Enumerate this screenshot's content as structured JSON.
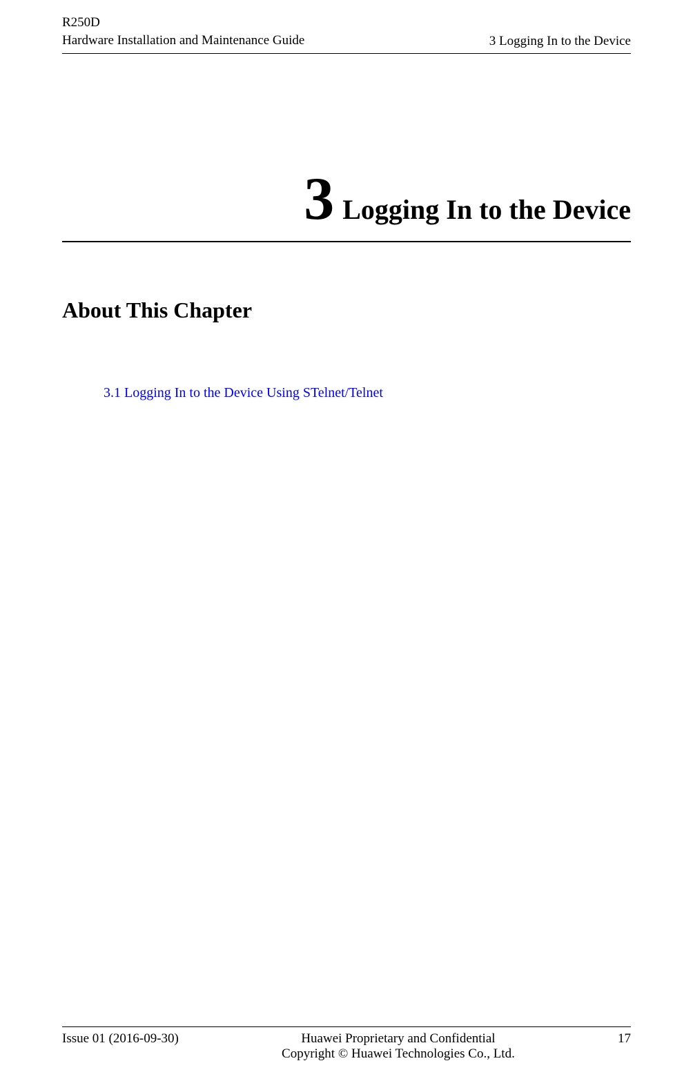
{
  "header": {
    "product": "R250D",
    "guide": "Hardware Installation and Maintenance Guide",
    "section": "3 Logging In to the Device"
  },
  "chapter": {
    "number": "3",
    "title": "Logging In to the Device"
  },
  "section_heading": "About This Chapter",
  "toc": {
    "link_3_1": "3.1 Logging In to the Device Using STelnet/Telnet"
  },
  "footer": {
    "issue": "Issue 01 (2016-09-30)",
    "proprietary": "Huawei Proprietary and Confidential",
    "copyright": "Copyright © Huawei Technologies Co., Ltd.",
    "page": "17"
  }
}
